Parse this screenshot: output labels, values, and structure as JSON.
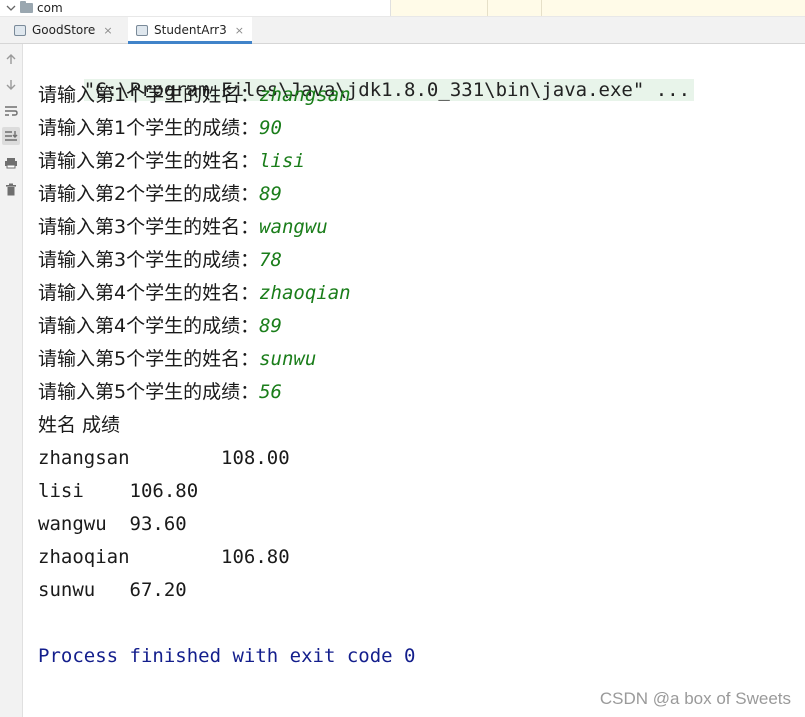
{
  "tree": {
    "folder_label": "com"
  },
  "tabs": [
    {
      "label": "GoodStore",
      "close": "×",
      "active": false
    },
    {
      "label": "StudentArr3",
      "close": "×",
      "active": true
    }
  ],
  "toolbar": {
    "icons": [
      "up-arrow-icon",
      "down-arrow-icon",
      "soft-wrap-icon",
      "scroll-to-end-icon",
      "print-icon",
      "trash-icon"
    ]
  },
  "console": {
    "command": "\"C:\\Program Files\\Java\\jdk1.8.0_331\\bin\\java.exe\" ...",
    "prompts": [
      {
        "prompt": "请输入第1个学生的姓名：",
        "value": "zhangsan"
      },
      {
        "prompt": "请输入第1个学生的成绩：",
        "value": "90"
      },
      {
        "prompt": "请输入第2个学生的姓名：",
        "value": "lisi"
      },
      {
        "prompt": "请输入第2个学生的成绩：",
        "value": "89"
      },
      {
        "prompt": "请输入第3个学生的姓名：",
        "value": "wangwu"
      },
      {
        "prompt": "请输入第3个学生的成绩：",
        "value": "78"
      },
      {
        "prompt": "请输入第4个学生的姓名：",
        "value": "zhaoqian"
      },
      {
        "prompt": "请输入第4个学生的成绩：",
        "value": "89"
      },
      {
        "prompt": "请输入第5个学生的姓名：",
        "value": "sunwu"
      },
      {
        "prompt": "请输入第5个学生的成绩：",
        "value": "56"
      }
    ],
    "header": "姓名 成绩",
    "results": [
      "zhangsan\t108.00",
      "lisi\t106.80",
      "wangwu\t93.60",
      "zhaoqian\t106.80",
      "sunwu\t67.20"
    ],
    "exit_message": "Process finished with exit code 0"
  },
  "watermark": "CSDN @a box of Sweets",
  "colors": {
    "input_value": "#1a7d1a",
    "exit_message": "#131e8c",
    "command_highlight": "#e8f4ea",
    "tab_accent": "#4083c9"
  }
}
